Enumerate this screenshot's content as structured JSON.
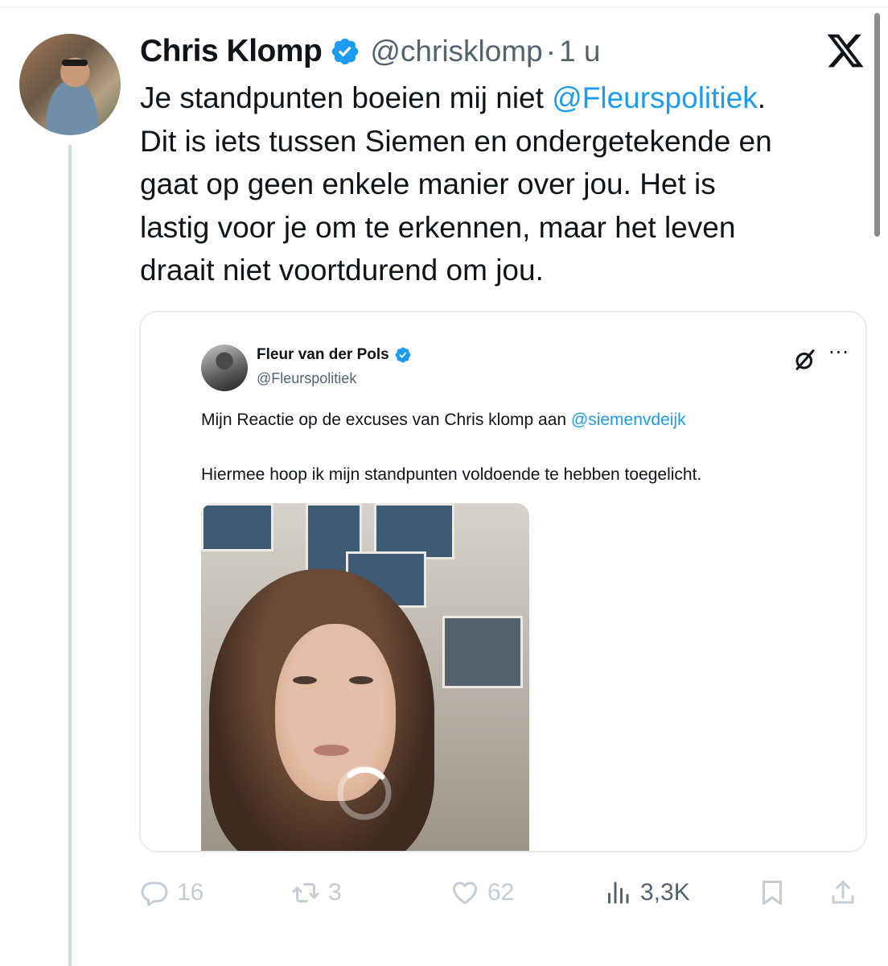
{
  "tweet": {
    "author_name": "Chris Klomp",
    "handle": "@chrisklomp",
    "separator": "·",
    "time": "1 u",
    "text_lines": [
      {
        "before": "Je standpunten boeien mij niet ",
        "mention": "@Fleurspolitiek",
        "after": "."
      },
      {
        "text": "Dit is iets tussen Siemen en ondergetekende en"
      },
      {
        "text": "gaat op geen enkele manier over jou. Het is"
      },
      {
        "text": "lastig voor je om te erkennen, maar het leven"
      },
      {
        "text": "draait niet voortdurend om jou."
      }
    ]
  },
  "quote": {
    "author_name": "Fleur van der Pols",
    "handle": "@Fleurspolitiek",
    "more_label": "···",
    "text_line1_before": "Mijn Reactie op de excuses van Chris klomp aan ",
    "text_line1_mention": "@siemenvdeijk",
    "text_line2": "Hiermee hoop ik mijn standpunten voldoende te hebben toegelicht."
  },
  "actions": {
    "replies": "16",
    "retweets": "3",
    "likes": "62",
    "views": "3,3K"
  },
  "icons": {
    "brand": "x-logo-icon",
    "verified": "verified-badge-icon",
    "grok": "grok-icon",
    "reply": "reply-icon",
    "retweet": "retweet-icon",
    "like": "heart-icon",
    "views": "views-icon",
    "bookmark": "bookmark-icon",
    "share": "share-icon"
  },
  "colors": {
    "link": "#1d9bf0",
    "verified": "#1d9bf0",
    "text": "#0f1419",
    "muted": "#536471",
    "action_muted": "#c3cdd5"
  }
}
